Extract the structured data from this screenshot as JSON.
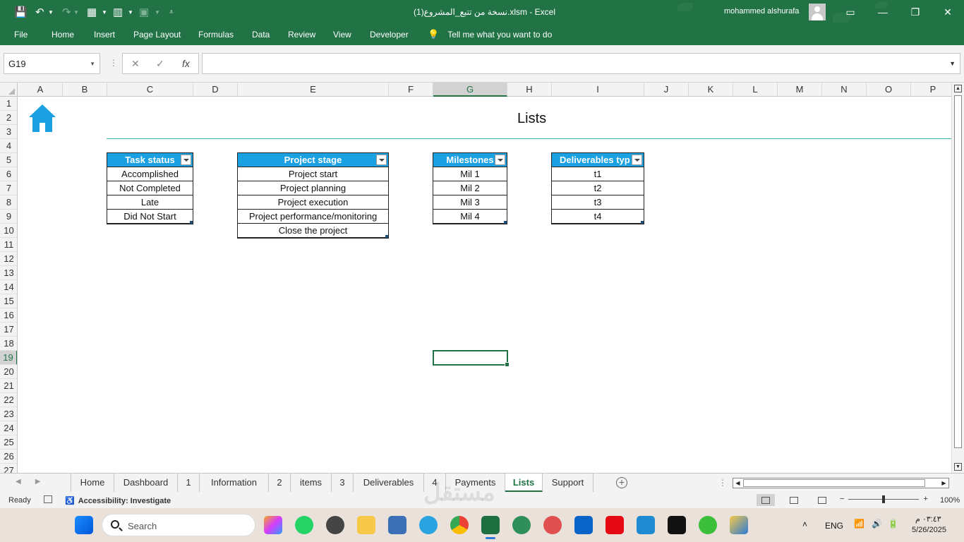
{
  "window": {
    "title": "نسخة من تتبع_المشروع(1).xlsm  -  Excel",
    "user": "mohammed alshurafa"
  },
  "ribbon": {
    "tabs": [
      "File",
      "Home",
      "Insert",
      "Page Layout",
      "Formulas",
      "Data",
      "Review",
      "View",
      "Developer"
    ],
    "tell_me": "Tell me what you want to do"
  },
  "formula_bar": {
    "name_box": "G19",
    "formula": ""
  },
  "columns": [
    "A",
    "B",
    "C",
    "D",
    "E",
    "F",
    "G",
    "H",
    "I",
    "J",
    "K",
    "L",
    "M",
    "N",
    "O",
    "P"
  ],
  "selected_column": "G",
  "rows": [
    "1",
    "2",
    "3",
    "4",
    "5",
    "6",
    "7",
    "8",
    "9",
    "10",
    "11",
    "12",
    "13",
    "14",
    "15",
    "16",
    "17",
    "18",
    "19",
    "20",
    "21",
    "22",
    "23",
    "24",
    "25",
    "26",
    "27"
  ],
  "selected_row": "19",
  "sheet": {
    "title": "Lists",
    "tables": [
      {
        "header": "Task status",
        "rows": [
          "Accomplished",
          "Not Completed",
          "Late",
          "Did Not Start"
        ]
      },
      {
        "header": "Project stage",
        "rows": [
          "Project start",
          "Project planning",
          "Project execution",
          "Project performance/monitoring",
          "Close the project"
        ]
      },
      {
        "header": "Milestones",
        "rows": [
          "Mil 1",
          "Mil 2",
          "Mil 3",
          "Mil 4"
        ]
      },
      {
        "header": "Deliverables typ",
        "rows": [
          "t1",
          "t2",
          "t3",
          "t4"
        ]
      }
    ]
  },
  "sheet_tabs": [
    "Home",
    "Dashboard",
    "1",
    "Information",
    "2",
    "items",
    "3",
    "Deliverables",
    "4",
    "Payments",
    "Lists",
    "Support"
  ],
  "active_tab": "Lists",
  "status": {
    "ready": "Ready",
    "accessibility": "Accessibility: Investigate",
    "zoom": "100%"
  },
  "taskbar": {
    "search_placeholder": "Search",
    "lang": "ENG",
    "time": "٠٣:٤٣ م",
    "date": "5/26/2025"
  },
  "watermark": "مستقل",
  "colors": {
    "excel_green": "#217346",
    "table_header": "#1ba1e2",
    "accent_line": "#35b1a5"
  }
}
